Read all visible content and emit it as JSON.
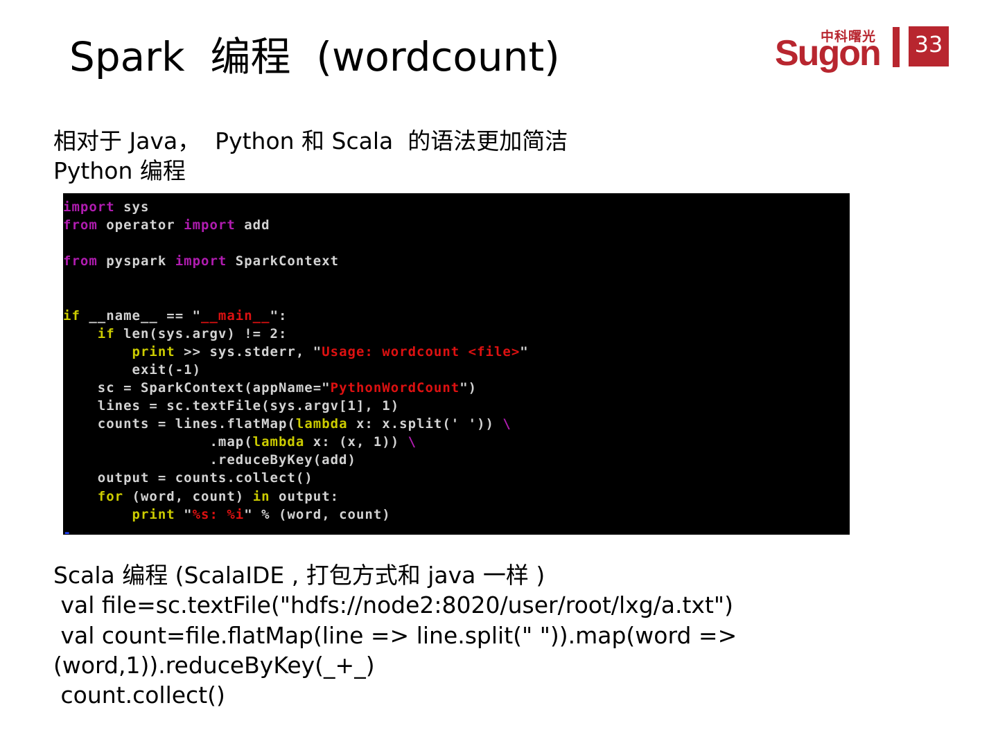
{
  "title": "Spark  编程  (wordcount)",
  "logo": {
    "chinese": "中科曙光",
    "english": "Sugon"
  },
  "page_number": "33",
  "intro": {
    "line1": "相对于 Java，  Python 和 Scala  的语法更加简洁",
    "line2": "Python 编程"
  },
  "python_code": {
    "l1_kw": "import",
    "l1_rest": " sys",
    "l2_kw1": "from",
    "l2_mid": " operator ",
    "l2_kw2": "import",
    "l2_rest": " add",
    "l3_kw1": "from",
    "l3_mid": " pyspark ",
    "l3_kw2": "import",
    "l3_rest": " SparkContext",
    "l4_kw": "if",
    "l4_a": " __name__ == \"",
    "l4_str": "__main__",
    "l4_b": "\":",
    "l5_kw": "if",
    "l5_rest": " len(sys.argv) != 2:",
    "l6_kw": "print",
    "l6_a": " >> sys.stderr, \"",
    "l6_str": "Usage: wordcount <file>",
    "l6_b": "\"",
    "l7": "exit(-1)",
    "l8_a": "sc = SparkContext(appName=\"",
    "l8_str": "PythonWordCount",
    "l8_b": "\")",
    "l9": "lines = sc.textFile(sys.argv[1], 1)",
    "l10_a": "counts = lines.flatMap(",
    "l10_kw": "lambda",
    "l10_b": " x: x.split(' ')) ",
    "l10_cont": "\\",
    "l11_a": ".map(",
    "l11_kw": "lambda",
    "l11_b": " x: (x, 1)) ",
    "l11_cont": "\\",
    "l12": ".reduceByKey(add)",
    "l13": "output = counts.collect()",
    "l14_kw1": "for",
    "l14_mid": " (word, count) ",
    "l14_kw2": "in",
    "l14_rest": " output:",
    "l15_kw": "print",
    "l15_a": " \"",
    "l15_str": "%s: %i",
    "l15_b": "\" % (word, count)",
    "cursor": "-"
  },
  "scala": {
    "heading": "Scala 编程 (ScalaIDE , 打包方式和 java 一样 )",
    "line1": " val file=sc.textFile(\"hdfs://node2:8020/user/root/lxg/a.txt\")",
    "line2": " val count=file.flatMap(line => line.split(\" \")).map(word =>",
    "line3": "(word,1)).reduceByKey(_+_)",
    "line4": " count.collect()"
  },
  "colors": {
    "brand_red": "#b8262f",
    "code_background": "#000000",
    "code_keyword": "#b01cb0",
    "code_keyword_yellow": "#cccc00",
    "code_string": "#dd1111",
    "code_text": "#d3d3d3"
  }
}
